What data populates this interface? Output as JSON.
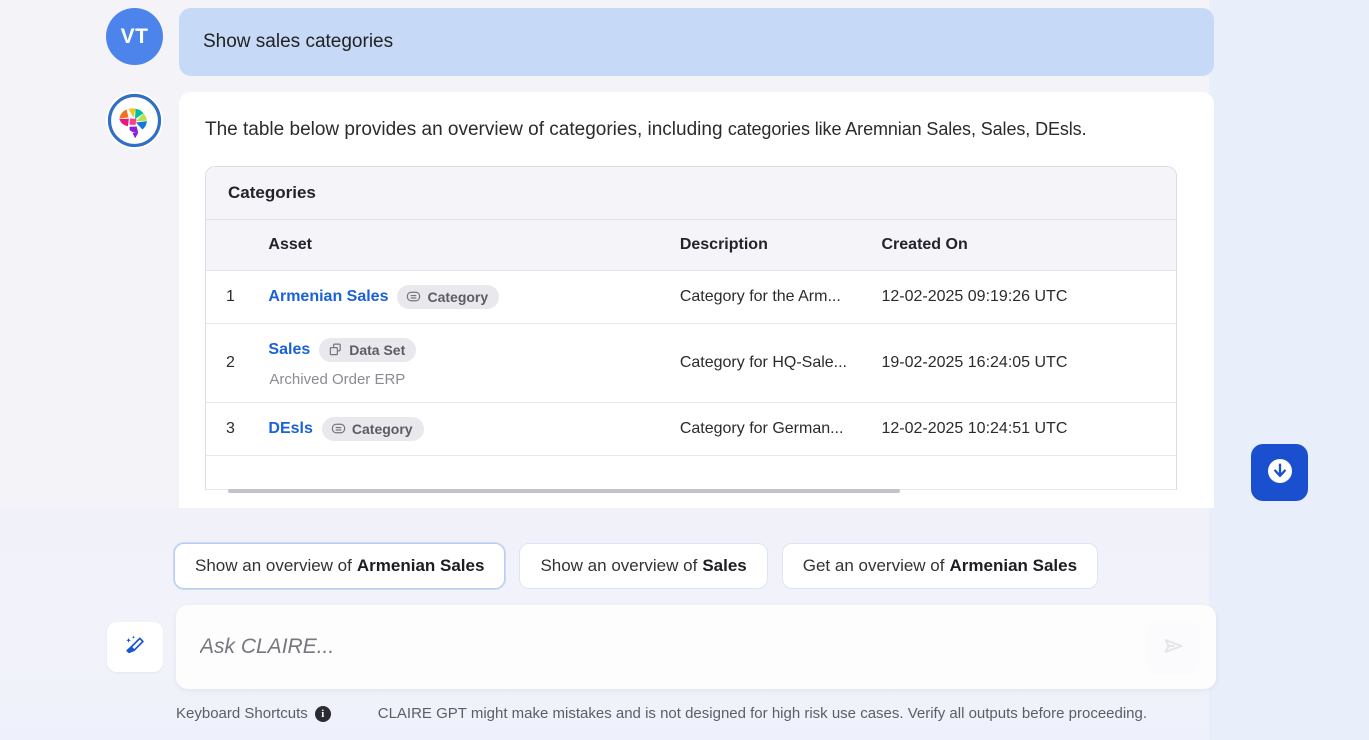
{
  "conversation": {
    "user_message": {
      "avatar_initials": "VT",
      "text": "Show sales categories"
    },
    "assistant_message": {
      "intro_main": "The table below provides an overview of categories, including",
      "intro_detail": "categories like Aremnian Sales, Sales, DEsls."
    }
  },
  "table": {
    "title": "Categories",
    "columns": [
      "",
      "Asset",
      "Description",
      "Created On"
    ],
    "rows": [
      {
        "index": "1",
        "asset": "Armenian Sales",
        "badge": "Category",
        "badge_icon": "category-icon",
        "subtitle": "",
        "description": "Category for the Arm...",
        "created_on": "12-02-2025 09:19:26 UTC"
      },
      {
        "index": "2",
        "asset": "Sales",
        "badge": "Data Set",
        "badge_icon": "data-set-icon",
        "subtitle": "Archived Order ERP",
        "description": "Category for HQ-Sale...",
        "created_on": "19-02-2025 16:24:05 UTC"
      },
      {
        "index": "3",
        "asset": "DEsls",
        "badge": "Category",
        "badge_icon": "category-icon",
        "subtitle": "",
        "description": "Category for German...",
        "created_on": "12-02-2025 10:24:51 UTC"
      }
    ]
  },
  "suggestions": [
    {
      "prefix": "Show an overview of",
      "entity": "Armenian Sales"
    },
    {
      "prefix": "Show an overview of",
      "entity": "Sales"
    },
    {
      "prefix": "Get an overview of",
      "entity": "Armenian Sales"
    }
  ],
  "composer": {
    "placeholder": "Ask CLAIRE...",
    "value": "",
    "clear_icon": "broom-sparkle-icon",
    "send_icon": "send-plane-icon"
  },
  "scroll_button": {
    "icon": "arrow-down-circle-icon"
  },
  "footer": {
    "shortcuts_label": "Keyboard Shortcuts",
    "info_glyph": "i",
    "disclaimer": "CLAIRE GPT might make mistakes and is not designed for high risk use cases. Verify all outputs before proceeding."
  },
  "colors": {
    "accent_blue": "#1a4fd0",
    "user_bubble": "#c6daf7",
    "avatar_blue": "#4c84ec",
    "link_blue": "#1a61d8",
    "page_bg": "#f3f3f8"
  }
}
